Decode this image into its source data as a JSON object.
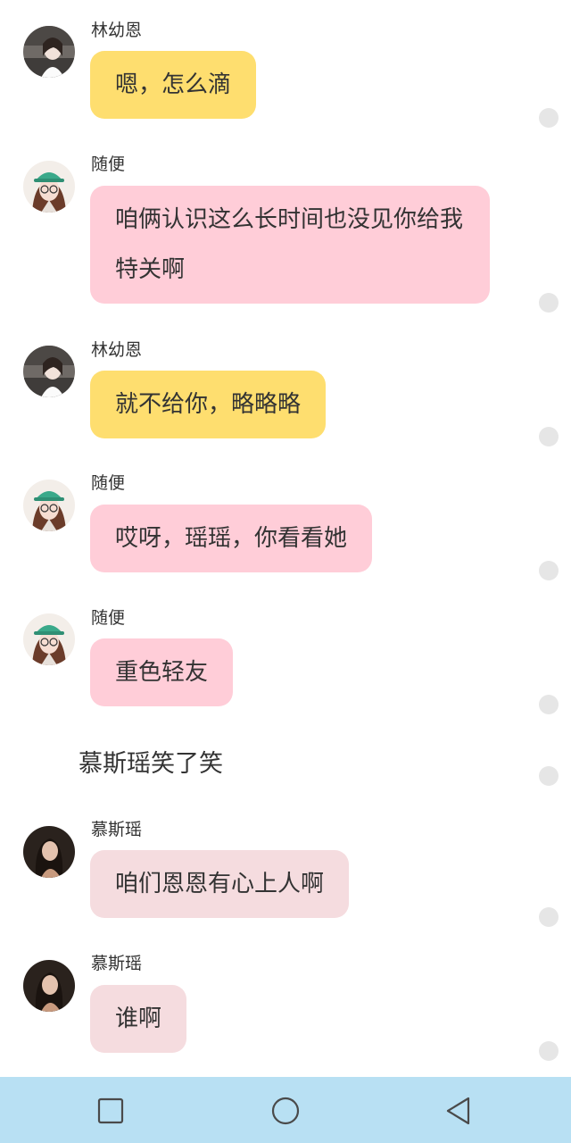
{
  "messages": [
    {
      "sender": "林幼恩",
      "text": "嗯，怎么滴",
      "color": "#fede6f",
      "avatar": "avatar-linyouen"
    },
    {
      "sender": "随便",
      "text": "咱俩认识这么长时间也没见你给我特关啊",
      "color": "#ffcdd8",
      "avatar": "avatar-suibian"
    },
    {
      "sender": "林幼恩",
      "text": "就不给你，略略略",
      "color": "#fede6f",
      "avatar": "avatar-linyouen"
    },
    {
      "sender": "随便",
      "text": "哎呀，瑶瑶，你看看她",
      "color": "#ffcdd8",
      "avatar": "avatar-suibian"
    },
    {
      "sender": "随便",
      "text": "重色轻友",
      "color": "#ffcdd8",
      "avatar": "avatar-suibian"
    },
    {
      "sender": "慕斯瑶",
      "text": "咱们恩恩有心上人啊",
      "color": "#f5dcdf",
      "avatar": "avatar-musiyao"
    },
    {
      "sender": "慕斯瑶",
      "text": "谁啊",
      "color": "#f5dcdf",
      "avatar": "avatar-musiyao"
    }
  ],
  "narration": "慕斯瑶笑了笑",
  "navbar": {
    "background": "#b8e0f3",
    "buttons": [
      "recents-square-icon",
      "home-circle-icon",
      "back-triangle-icon"
    ]
  }
}
